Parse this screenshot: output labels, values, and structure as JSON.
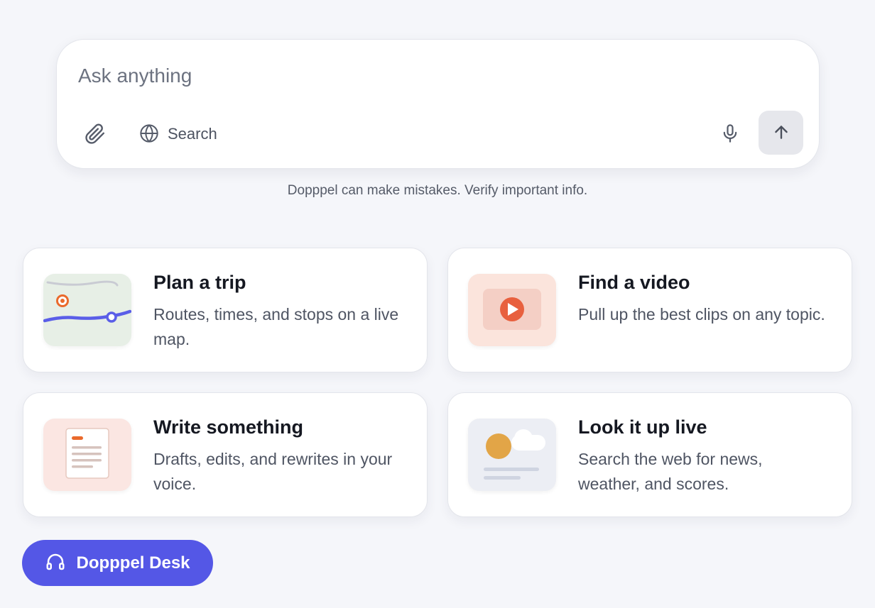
{
  "composer": {
    "placeholder": "Ask anything",
    "search_label": "Search",
    "icons": [
      "paperclip-icon",
      "globe-icon",
      "microphone-icon",
      "arrow-up-icon"
    ]
  },
  "disclaimer": "Dopppel can make mistakes. Verify important info.",
  "cards": [
    {
      "title": "Plan a trip",
      "description": "Routes, times, and stops on a live map.",
      "icon": "map-thumbnail"
    },
    {
      "title": "Find a video",
      "description": "Pull up the best clips on any topic.",
      "icon": "video-thumbnail"
    },
    {
      "title": "Write something",
      "description": "Drafts, edits, and rewrites in your voice.",
      "icon": "document-thumbnail"
    },
    {
      "title": "Look it up live",
      "description": "Search the web for news, weather, and scores.",
      "icon": "weather-thumbnail"
    }
  ],
  "desk_button": {
    "label": "Dopppel Desk",
    "icon": "headset-icon"
  },
  "colors": {
    "background": "#f5f6fa",
    "accent": "#5457e6",
    "send_button": "#e6e7ec",
    "map_route": "#5a5ee8",
    "map_pin": "#ea6a2c",
    "video_play": "#e8603e",
    "sun": "#e2a547"
  }
}
